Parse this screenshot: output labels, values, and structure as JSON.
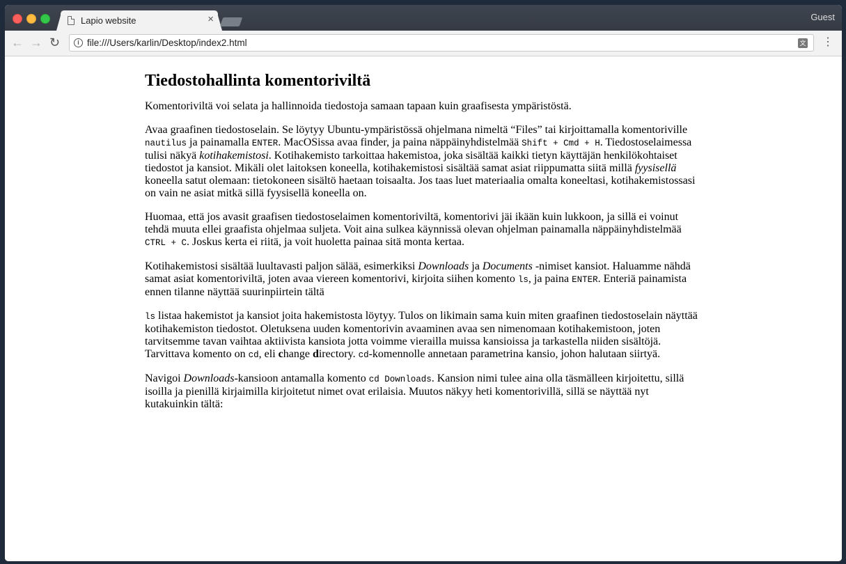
{
  "browser": {
    "tab_title": "Lapio website",
    "tab_close": "×",
    "guest_label": "Guest",
    "url": "file:///Users/karlin/Desktop/index2.html",
    "back_icon": "←",
    "forward_icon": "→",
    "reload_icon": "↻",
    "info_icon": "i",
    "translate_icon": "文",
    "menu_icon": "⋮"
  },
  "article": {
    "title": "Tiedostohallinta komentoriviltä",
    "p1": "Komentoriviltä voi selata ja hallinnoida tiedostoja samaan tapaan kuin graafisesta ympäristöstä.",
    "p2": {
      "t1": "Avaa graafinen tiedostoselain. Se löytyy Ubuntu-ympäristössä ohjelmana nimeltä “Files” tai kirjoittamalla komentoriville ",
      "c1": "nautilus",
      "t2": " ja painamalla ",
      "c2": "ENTER",
      "t3": ". MacOSissa avaa finder, ja paina näppäinyhdistelmää ",
      "c3": "Shift + Cmd + H",
      "t4": ". Tiedostoselaimessa tulisi näkyä ",
      "e1": "kotihakemistosi",
      "t5": ". Kotihakemisto tarkoittaa hakemistoa, joka sisältää kaikki tietyn käyttäjän henkilökohtaiset tiedostot ja kansiot. Mikäli olet laitoksen koneella, kotihakemistosi sisältää samat asiat riippumatta siitä millä ",
      "e2": "fyysisellä",
      "t6": " koneella satut olemaan: tietokoneen sisältö haetaan toisaalta. Jos taas luet materiaalia omalta koneeltasi, kotihakemistossasi on vain ne asiat mitkä sillä fyysisellä koneella on."
    },
    "p3": {
      "t1": "Huomaa, että jos avasit graafisen tiedostoselaimen komentoriviltä, komentorivi jäi ikään kuin lukkoon, ja sillä ei voinut tehdä muuta ellei graafista ohjelmaa suljeta. Voit aina sulkea käynnissä olevan ohjelman painamalla näppäinyhdistelmää ",
      "c1": "CTRL + C",
      "t2": ". Joskus kerta ei riitä, ja voit huoletta painaa sitä monta kertaa."
    },
    "p4": {
      "t1": "Kotihakemistosi sisältää luultavasti paljon sälää, esimerkiksi ",
      "e1": "Downloads",
      "t2": " ja ",
      "e2": "Documents",
      "t3": " -nimiset kansiot. Haluamme nähdä samat asiat komentoriviltä, joten avaa viereen komentorivi, kirjoita siihen komento ",
      "c1": "ls",
      "t4": ", ja paina ",
      "c2": "ENTER",
      "t5": ". Enteriä painamista ennen tilanne näyttää suurinpiirtein tältä"
    },
    "p5": {
      "c1": "ls",
      "t1": " listaa hakemistot ja kansiot joita hakemistosta löytyy. Tulos on likimain sama kuin miten graafinen tiedostoselain näyttää kotihakemiston tiedostot. Oletuksena uuden komentorivin avaaminen avaa sen nimenomaan kotihakemistoon, joten tarvitsemme tavan vaihtaa aktiivista kansiota jotta voimme vierailla muissa kansioissa ja tarkastella niiden sisältöjä. Tarvittava komento on ",
      "c2": "cd",
      "t2": ", eli ",
      "b1": "c",
      "t3": "hange ",
      "b2": "d",
      "t4": "irectory. ",
      "c3": "cd",
      "t5": "-komennolle annetaan parametrina kansio, johon halutaan siirtyä."
    },
    "p6": {
      "t1": "Navigoi ",
      "e1": "Downloads",
      "t2": "-kansioon antamalla komento ",
      "c1": "cd Downloads",
      "t3": ". Kansion nimi tulee aina olla täsmälleen kirjoitettu, sillä isoilla ja pienillä kirjaimilla kirjoitetut nimet ovat erilaisia. Muutos näkyy heti komentorivillä, sillä se näyttää nyt kutakuinkin tältä:"
    }
  }
}
